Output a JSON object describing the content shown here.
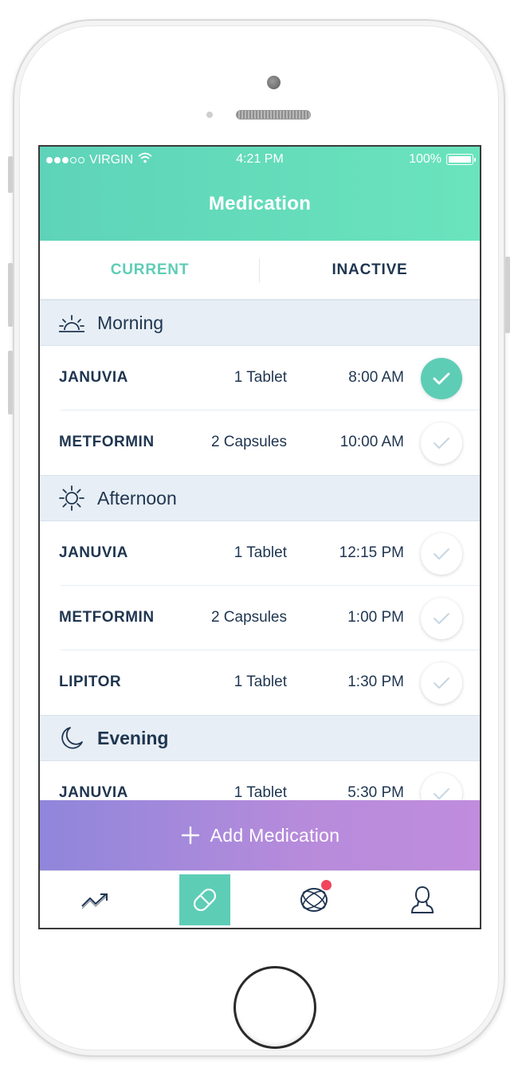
{
  "status_bar": {
    "carrier": "VIRGIN",
    "time": "4:21 PM",
    "battery": "100%",
    "signal_bars_filled": 3,
    "signal_bars_total": 5
  },
  "header": {
    "title": "Medication"
  },
  "tabs": [
    {
      "label": "CURRENT",
      "active": true
    },
    {
      "label": "INACTIVE",
      "active": false
    }
  ],
  "sections": [
    {
      "label": "Morning",
      "icon": "sunrise-icon",
      "rows": [
        {
          "name": "JANUVIA",
          "dose": "1 Tablet",
          "time": "8:00 AM",
          "taken": true
        },
        {
          "name": "METFORMIN",
          "dose": "2 Capsules",
          "time": "10:00 AM",
          "taken": false
        }
      ]
    },
    {
      "label": "Afternoon",
      "icon": "sun-icon",
      "rows": [
        {
          "name": "JANUVIA",
          "dose": "1 Tablet",
          "time": "12:15 PM",
          "taken": false
        },
        {
          "name": "METFORMIN",
          "dose": "2 Capsules",
          "time": "1:00 PM",
          "taken": false
        },
        {
          "name": "LIPITOR",
          "dose": "1 Tablet",
          "time": "1:30 PM",
          "taken": false
        }
      ]
    },
    {
      "label": "Evening",
      "icon": "moon-icon",
      "rows": [
        {
          "name": "JANUVIA",
          "dose": "1 Tablet",
          "time": "5:30 PM",
          "taken": false
        }
      ]
    }
  ],
  "add_button": {
    "label": "Add Medication"
  },
  "tab_bar": [
    {
      "icon": "trend-chart-icon",
      "active": false
    },
    {
      "icon": "pill-icon",
      "active": true
    },
    {
      "icon": "community-globe-icon",
      "active": false,
      "has_notification": true
    },
    {
      "icon": "profile-icon",
      "active": false
    }
  ],
  "colors": {
    "accent": "#5ecdb6",
    "text_dark": "#1f3550",
    "section_bg": "#e7eef5",
    "add_gradient_start": "#8f86db",
    "add_gradient_end": "#c08cdd",
    "notification": "#f0455b"
  }
}
